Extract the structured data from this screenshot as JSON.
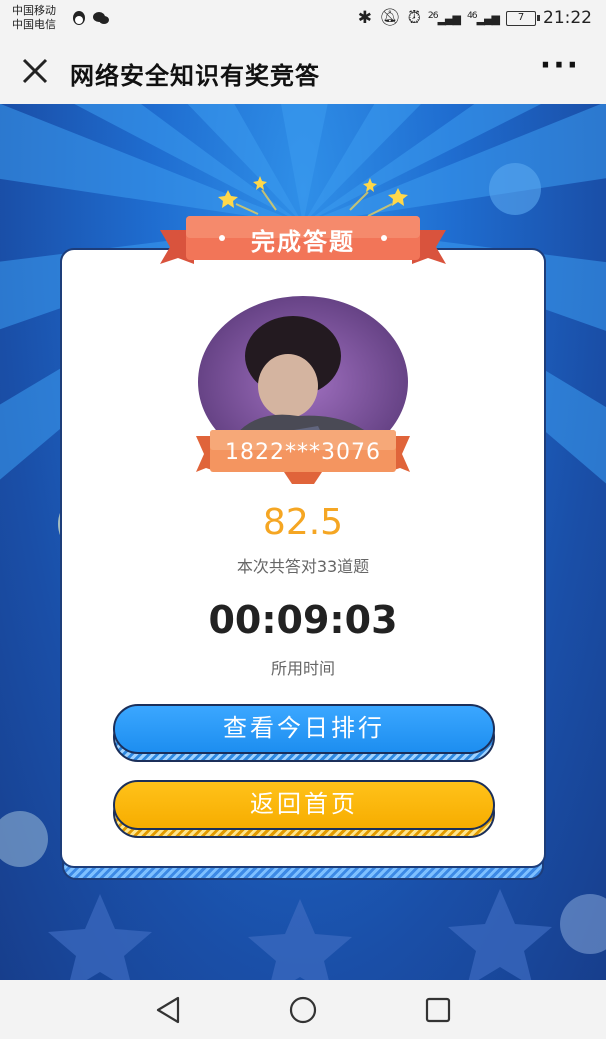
{
  "status_bar": {
    "carrier_1": "中国移动",
    "carrier_2": "中国电信",
    "network_1": "26",
    "network_2": "46",
    "battery": "7",
    "time": "21:22"
  },
  "title_bar": {
    "title": "网络安全知识有奖竞答"
  },
  "result": {
    "header": "完成答题",
    "user_id": "1822***3076",
    "score": "82.5",
    "score_desc": "本次共答对33道题",
    "time_used": "00:09:03",
    "time_label": "所用时间"
  },
  "buttons": {
    "ranking": "查看今日排行",
    "home": "返回首页"
  },
  "colors": {
    "accent_orange": "#f5a623",
    "button_blue": "#1d8ef0",
    "button_yellow": "#f7ad00",
    "ribbon": "#f0654a"
  }
}
